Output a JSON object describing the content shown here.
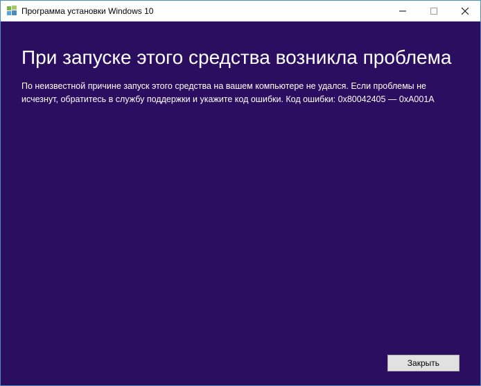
{
  "titlebar": {
    "title": "Программа установки Windows 10"
  },
  "content": {
    "heading": "При запуске этого средства возникла проблема",
    "message": "По неизвестной причине запуск этого средства на вашем компьютере не удался. Если проблемы не исчезнут, обратитесь в службу поддержки и укажите код ошибки. Код ошибки: 0x80042405 — 0xA001A"
  },
  "buttons": {
    "close": "Закрыть"
  }
}
